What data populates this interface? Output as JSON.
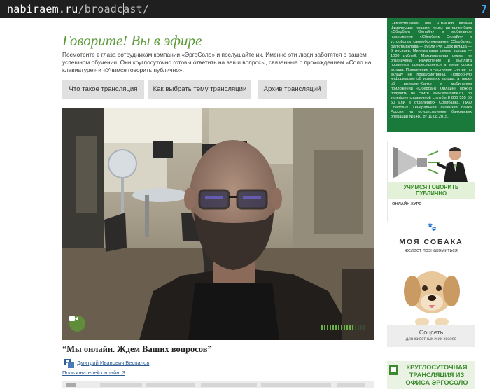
{
  "browser": {
    "url_host": "nabiraem.ru",
    "url_path": "/broadcast/",
    "tab_number": "7"
  },
  "page": {
    "heading": "Говорите! Вы в эфире",
    "intro": "Посмотрите в глаза сотрудникам компании «ЭргоСоло» и послушайте их. Именно эти люди заботятся о вашем успешном обучении. Они круглосуточно готовы ответить на ваши вопросы, связанные с прохождением «Соло на клавиатуре» и «Учимся говорить публично».",
    "nav": [
      {
        "label": "Что такое трансляция"
      },
      {
        "label": "Как выбрать тему трансляции"
      },
      {
        "label": "Архив трансляций"
      }
    ],
    "caption": "“Мы онлайн. Ждем Ваших вопросов”",
    "host_name": "Дмитрий Иванович Беспалов",
    "online_users": "Пользователей онлайн: 3"
  },
  "video": {
    "volume_level": 0.75
  },
  "sidebar": {
    "sber_text": "...включительно при открытии вклада физическим лицами через интернет-банк «Сбербанк Онлайн» и мобильное приложение «Сбербанк Онлайн» и устройства самообслуживания Сбербанка. Валюта вклада — рубли РФ. Срок вклада — 6 месяцев. Минимальная сумма вклада — 1000 рублей. Максимальная сумма не ограничена. Начисление и выплата процентов осуществляется в конце срока вклада. Пополнение и частичное снятие по вкладу не предусмотрены. Подробную информацию об условиях вклада, а также об интернет-банке и мобильном приложении «Сбербанк Онлайн» можно получить на сайте www.sberbank.ru, по телефону справочной службы 8 800 555 55 50 или в отделениях Сбербанка. ПАО Сбербанк. Генеральная лицензия банка России на осуществление банковских операций №1481 от 11.08.2015.",
    "course_title": "УЧИМСЯ ГОВОРИТЬ ПУБЛИЧНО",
    "course_sub": "ОНЛАЙН-КУРС",
    "dog_title": "МОЯ СОБАКА",
    "dog_sub": "желает познакомиться",
    "dog_footer1": "Соцсеть",
    "dog_footer2": "для животных и их хозяев",
    "round_text": "КРУГЛОСУТОЧНАЯ ТРАНСЛЯЦИЯ ИЗ ОФИСА ЭРГОСОЛО"
  },
  "colors": {
    "accent_green": "#5c9a3a",
    "sber_green": "#1a7a3c",
    "link_blue": "#2f5d96"
  }
}
